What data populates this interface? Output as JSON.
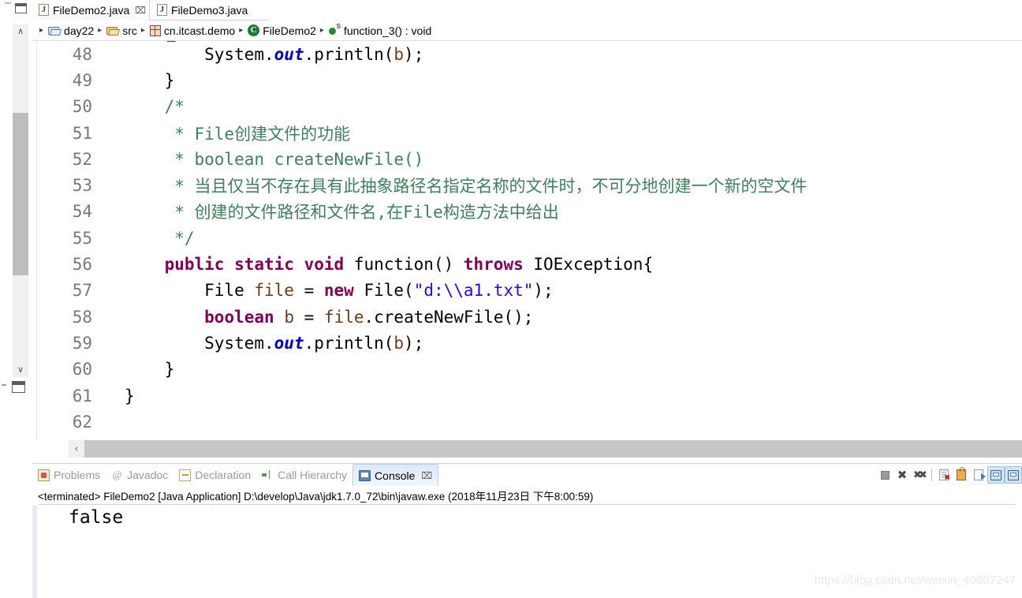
{
  "editor_tabs": [
    {
      "label": "FileDemo2.java",
      "icon": "java-file-icon",
      "active": true,
      "close": "⌧"
    },
    {
      "label": "FileDemo3.java",
      "icon": "java-file-icon",
      "active": false,
      "close": ""
    }
  ],
  "breadcrumb": {
    "separator": "▸",
    "items": [
      {
        "label": "day22",
        "icon": "project-folder-icon"
      },
      {
        "label": "src",
        "icon": "source-folder-icon"
      },
      {
        "label": "cn.itcast.demo",
        "icon": "package-icon"
      },
      {
        "label": "FileDemo2",
        "icon": "class-icon"
      },
      {
        "label": "function_3() : void",
        "icon": "static-method-icon"
      }
    ]
  },
  "editor": {
    "clipped_top_fragment": "\u0000",
    "first_visible_line": 48,
    "lines": [
      {
        "num": "48",
        "tokens": [
          {
            "t": "        System.",
            "c": "plain"
          },
          {
            "t": "out",
            "c": "fld"
          },
          {
            "t": ".println(",
            "c": "plain"
          },
          {
            "t": "b",
            "c": "loc"
          },
          {
            "t": ");",
            "c": "plain"
          }
        ]
      },
      {
        "num": "49",
        "tokens": [
          {
            "t": "    }",
            "c": "plain"
          }
        ]
      },
      {
        "num": "50",
        "tokens": [
          {
            "t": "    /*",
            "c": "cmt"
          }
        ]
      },
      {
        "num": "51",
        "tokens": [
          {
            "t": "     * File创建文件的功能",
            "c": "cmt"
          }
        ]
      },
      {
        "num": "52",
        "tokens": [
          {
            "t": "     * boolean createNewFile()",
            "c": "cmt"
          }
        ]
      },
      {
        "num": "53",
        "tokens": [
          {
            "t": "     * 当且仅当不存在具有此抽象路径名指定名称的文件时，不可分地创建一个新的空文件",
            "c": "cmt"
          }
        ]
      },
      {
        "num": "54",
        "tokens": [
          {
            "t": "     * 创建的文件路径和文件名,在File构造方法中给出",
            "c": "cmt"
          }
        ]
      },
      {
        "num": "55",
        "tokens": [
          {
            "t": "     */",
            "c": "cmt"
          }
        ]
      },
      {
        "num": "56",
        "tokens": [
          {
            "t": "    ",
            "c": "plain"
          },
          {
            "t": "public static void",
            "c": "kw"
          },
          {
            "t": " function() ",
            "c": "plain"
          },
          {
            "t": "throws",
            "c": "kw"
          },
          {
            "t": " IOException{",
            "c": "plain"
          }
        ]
      },
      {
        "num": "57",
        "tokens": [
          {
            "t": "        File ",
            "c": "plain"
          },
          {
            "t": "file",
            "c": "loc"
          },
          {
            "t": " = ",
            "c": "plain"
          },
          {
            "t": "new",
            "c": "kw"
          },
          {
            "t": " File(",
            "c": "plain"
          },
          {
            "t": "\"d:\\\\a1.txt\"",
            "c": "str"
          },
          {
            "t": ");",
            "c": "plain"
          }
        ]
      },
      {
        "num": "58",
        "tokens": [
          {
            "t": "        ",
            "c": "plain"
          },
          {
            "t": "boolean",
            "c": "kw"
          },
          {
            "t": " ",
            "c": "plain"
          },
          {
            "t": "b",
            "c": "loc"
          },
          {
            "t": " = ",
            "c": "plain"
          },
          {
            "t": "file",
            "c": "loc"
          },
          {
            "t": ".createNewFile();",
            "c": "plain"
          }
        ]
      },
      {
        "num": "59",
        "tokens": [
          {
            "t": "        System.",
            "c": "plain"
          },
          {
            "t": "out",
            "c": "fld"
          },
          {
            "t": ".println(",
            "c": "plain"
          },
          {
            "t": "b",
            "c": "loc"
          },
          {
            "t": ");",
            "c": "plain"
          }
        ]
      },
      {
        "num": "60",
        "tokens": [
          {
            "t": "    }",
            "c": "plain"
          }
        ]
      },
      {
        "num": "61",
        "tokens": [
          {
            "t": "}",
            "c": "plain"
          }
        ]
      },
      {
        "num": "62",
        "tokens": [
          {
            "t": "",
            "c": "plain"
          }
        ]
      }
    ]
  },
  "view_tabs": [
    {
      "label": "Problems",
      "icon": "problems-icon",
      "active": false,
      "close": ""
    },
    {
      "label": "Javadoc",
      "icon": "javadoc-icon",
      "active": false,
      "close": ""
    },
    {
      "label": "Declaration",
      "icon": "declaration-icon",
      "active": false,
      "close": ""
    },
    {
      "label": "Call Hierarchy",
      "icon": "call-hierarchy-icon",
      "active": false,
      "close": ""
    },
    {
      "label": "Console",
      "icon": "console-icon",
      "active": true,
      "close": "⌧"
    }
  ],
  "console_toolbar": [
    {
      "name": "terminate-button",
      "icon": "stop-icon",
      "toggled": false
    },
    {
      "name": "remove-launch-button",
      "icon": "remove-icon",
      "toggled": false
    },
    {
      "name": "remove-all-terminated-button",
      "icon": "remove-all-icon",
      "toggled": false
    },
    {
      "name": "clear-console-button",
      "icon": "clear-console-icon",
      "toggled": false
    },
    {
      "name": "scroll-lock-button",
      "icon": "lock-icon",
      "toggled": false
    },
    {
      "name": "pin-console-button",
      "icon": "pin-console-icon",
      "toggled": false
    },
    {
      "name": "display-selected-console-button",
      "icon": "display-console-icon",
      "toggled": true
    },
    {
      "name": "open-console-button",
      "icon": "open-console-icon",
      "toggled": true
    }
  ],
  "console": {
    "description": "<terminated> FileDemo2 [Java Application] D:\\develop\\Java\\jdk1.7.0_72\\bin\\javaw.exe (2018年11月23日 下午8:00:59)",
    "output": "false"
  },
  "watermark": "https://blog.csdn.net/weixin_40807247",
  "scrollbars": {
    "editor_vertical_up": "∧",
    "editor_vertical_down": "∨",
    "editor_horizontal_left": "‹"
  },
  "colors": {
    "keyword": "#7F0055",
    "string": "#2A00FF",
    "comment": "#3F7F5F",
    "static_field": "#0000C0",
    "local_var": "#6A3C1E",
    "line_number": "#787878",
    "tab_active_border": "#C8D4EA",
    "view_tab_active_bg": "#DCE8F8"
  }
}
